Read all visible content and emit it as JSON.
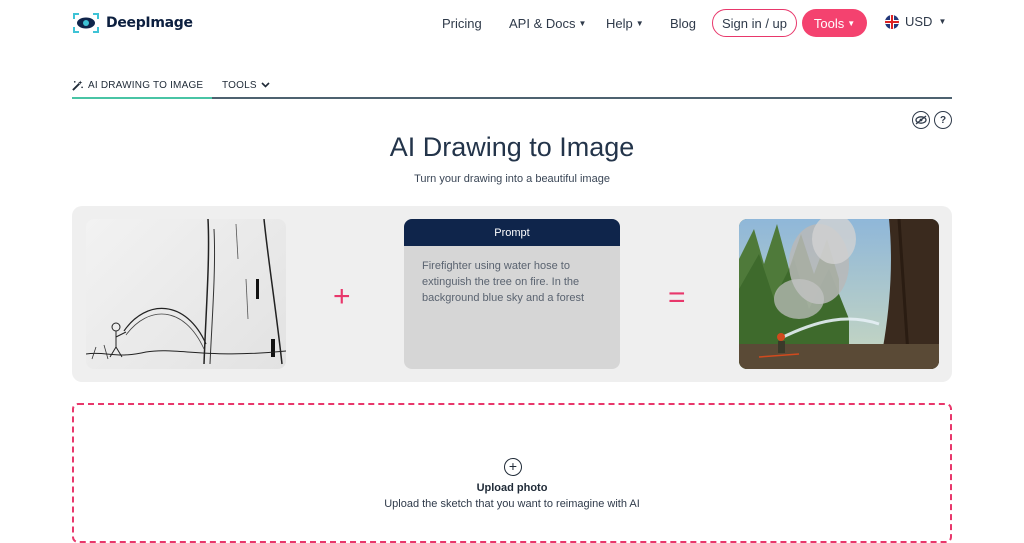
{
  "brand": {
    "name": "DeepImage"
  },
  "nav": {
    "pricing": "Pricing",
    "api_docs": "API & Docs",
    "help": "Help",
    "blog": "Blog",
    "signin": "Sign in / up",
    "tools": "Tools",
    "currency": "USD"
  },
  "subtabs": {
    "active": "AI DRAWING TO IMAGE",
    "tools": "TOOLS"
  },
  "hero": {
    "title": "AI Drawing to Image",
    "subtitle": "Turn your drawing into a beautiful image"
  },
  "example": {
    "plus": "+",
    "equals": "=",
    "prompt_header": "Prompt",
    "prompt_text": "Firefighter using water hose to extinguish the tree on fire. In the background blue sky and a forest"
  },
  "upload": {
    "title": "Upload photo",
    "subtitle": "Upload the sketch that you want to reimagine with AI"
  },
  "colors": {
    "accent": "#f4426f",
    "navy": "#0f254b",
    "teal": "#48c4a5"
  }
}
